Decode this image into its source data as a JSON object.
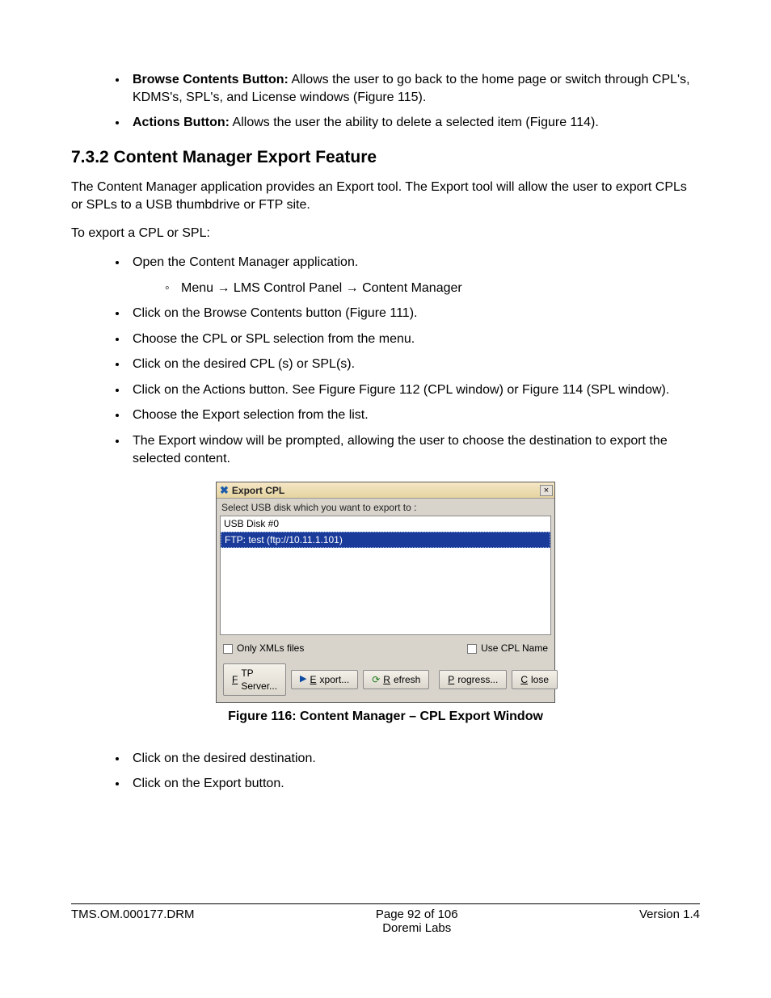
{
  "intro_bullets": [
    {
      "bold": "Browse Contents Button:",
      "rest": " Allows the user to go back to the home page or switch through CPL's, KDMS's, SPL's, and License windows (Figure 115)."
    },
    {
      "bold": "Actions Button:",
      "rest": " Allows the user the ability to delete a selected item (Figure 114)."
    }
  ],
  "section_heading": "7.3.2 Content Manager Export Feature",
  "para1": "The Content Manager application provides an Export tool. The Export tool will allow the user to export CPLs or SPLs to a USB thumbdrive or FTP site.",
  "para2": "To export a CPL or SPL:",
  "steps": [
    "Open the Content Manager application.",
    "Click on the Browse Contents button (Figure 111).",
    "Choose the CPL or SPL selection from the menu.",
    "Click on the desired CPL (s) or SPL(s).",
    "Click on the Actions button. See Figure Figure 112 (CPL window) or Figure 114 (SPL window).",
    "Choose the Export selection from the list.",
    "The Export window will be prompted, allowing the user to choose the destination to export the selected content."
  ],
  "substep": "Menu → LMS Control Panel → Content Manager",
  "dialog": {
    "title": "Export CPL",
    "prompt": "Select USB disk which you want to export to :",
    "items": [
      {
        "label": "USB Disk #0",
        "selected": false
      },
      {
        "label": "FTP: test (ftp://10.11.1.101)",
        "selected": true
      }
    ],
    "chk_only_xmls": "Only XMLs files",
    "chk_use_cpl": "Use CPL Name",
    "buttons": {
      "ftp": {
        "u": "F",
        "rest": "TP Server..."
      },
      "export": {
        "u": "E",
        "rest": "xport..."
      },
      "refresh": {
        "u": "R",
        "rest": "efresh"
      },
      "progress": {
        "u": "P",
        "rest": "rogress..."
      },
      "close": {
        "u": "C",
        "rest": "lose"
      }
    }
  },
  "figure_caption": "Figure 116: Content Manager – CPL Export Window",
  "after_bullets": [
    "Click on the desired destination.",
    "Click on the Export button."
  ],
  "footer": {
    "left": "TMS.OM.000177.DRM",
    "center_top": "Page 92 of 106",
    "center_bottom": "Doremi Labs",
    "right": "Version 1.4"
  }
}
